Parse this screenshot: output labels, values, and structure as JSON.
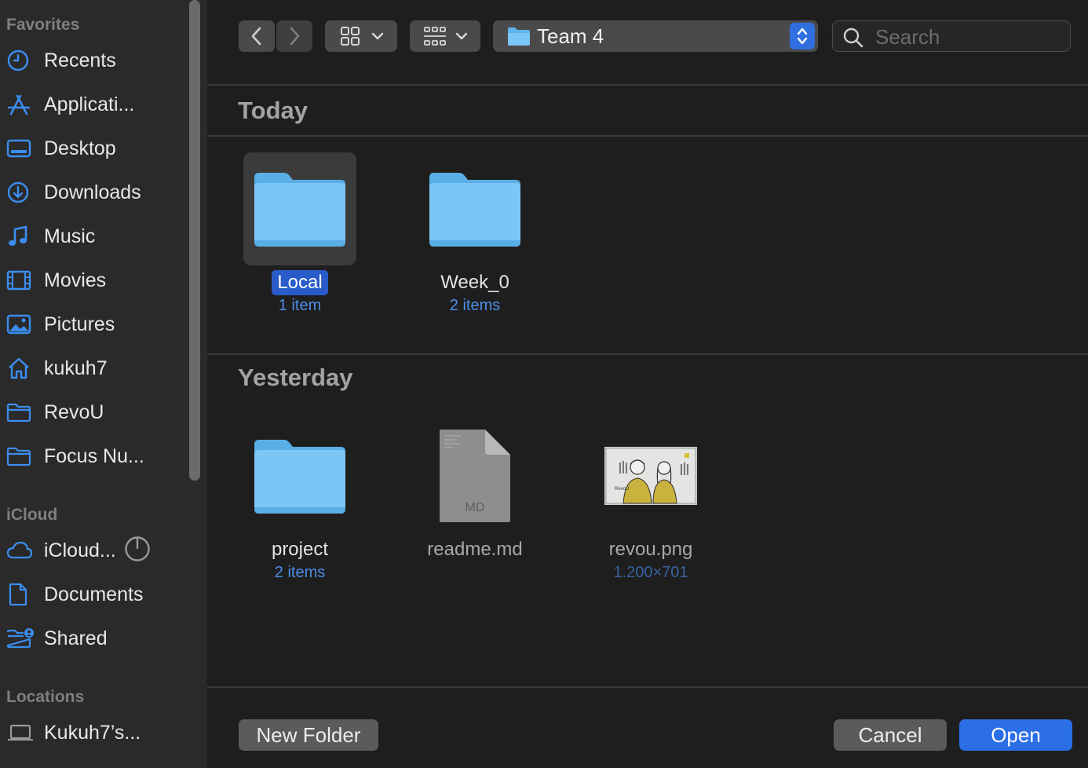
{
  "sidebar": {
    "favorites_title": "Favorites",
    "favorites": [
      {
        "label": "Recents",
        "icon": "clock-icon"
      },
      {
        "label": "Applicati...",
        "icon": "applications-icon"
      },
      {
        "label": "Desktop",
        "icon": "desktop-icon"
      },
      {
        "label": "Downloads",
        "icon": "download-icon"
      },
      {
        "label": "Music",
        "icon": "music-note-icon"
      },
      {
        "label": "Movies",
        "icon": "film-icon"
      },
      {
        "label": "Pictures",
        "icon": "photo-icon"
      },
      {
        "label": "kukuh7",
        "icon": "home-icon"
      },
      {
        "label": "RevoU",
        "icon": "folder-icon"
      },
      {
        "label": "Focus Nu...",
        "icon": "folder-icon"
      }
    ],
    "icloud_title": "iCloud",
    "icloud": [
      {
        "label": "iCloud...",
        "icon": "cloud-icon"
      },
      {
        "label": "Documents",
        "icon": "document-icon"
      },
      {
        "label": "Shared",
        "icon": "shared-folder-icon"
      }
    ],
    "locations_title": "Locations",
    "locations": [
      {
        "label": "Kukuh7’s...",
        "icon": "laptop-icon"
      }
    ]
  },
  "toolbar": {
    "path_name": "Team 4",
    "search_placeholder": "Search"
  },
  "groups": [
    {
      "title": "Today",
      "items": [
        {
          "name": "Local",
          "sub": "1 item",
          "kind": "folder"
        },
        {
          "name": "Week_0",
          "sub": "2 items",
          "kind": "folder"
        }
      ]
    },
    {
      "title": "Yesterday",
      "items": [
        {
          "name": "project",
          "sub": "2 items",
          "kind": "folder"
        },
        {
          "name": "readme.md",
          "sub": "",
          "kind": "document",
          "badge": "MD"
        },
        {
          "name": "revou.png",
          "sub": "1.200×701",
          "kind": "image",
          "image_caption": "RevoU"
        }
      ]
    }
  ],
  "footer": {
    "new_folder": "New Folder",
    "cancel": "Cancel",
    "open": "Open"
  },
  "colors": {
    "accent": "#2b6ee6",
    "sidebar_icon": "#3b8ef0",
    "folder": "#7cc6f5"
  }
}
